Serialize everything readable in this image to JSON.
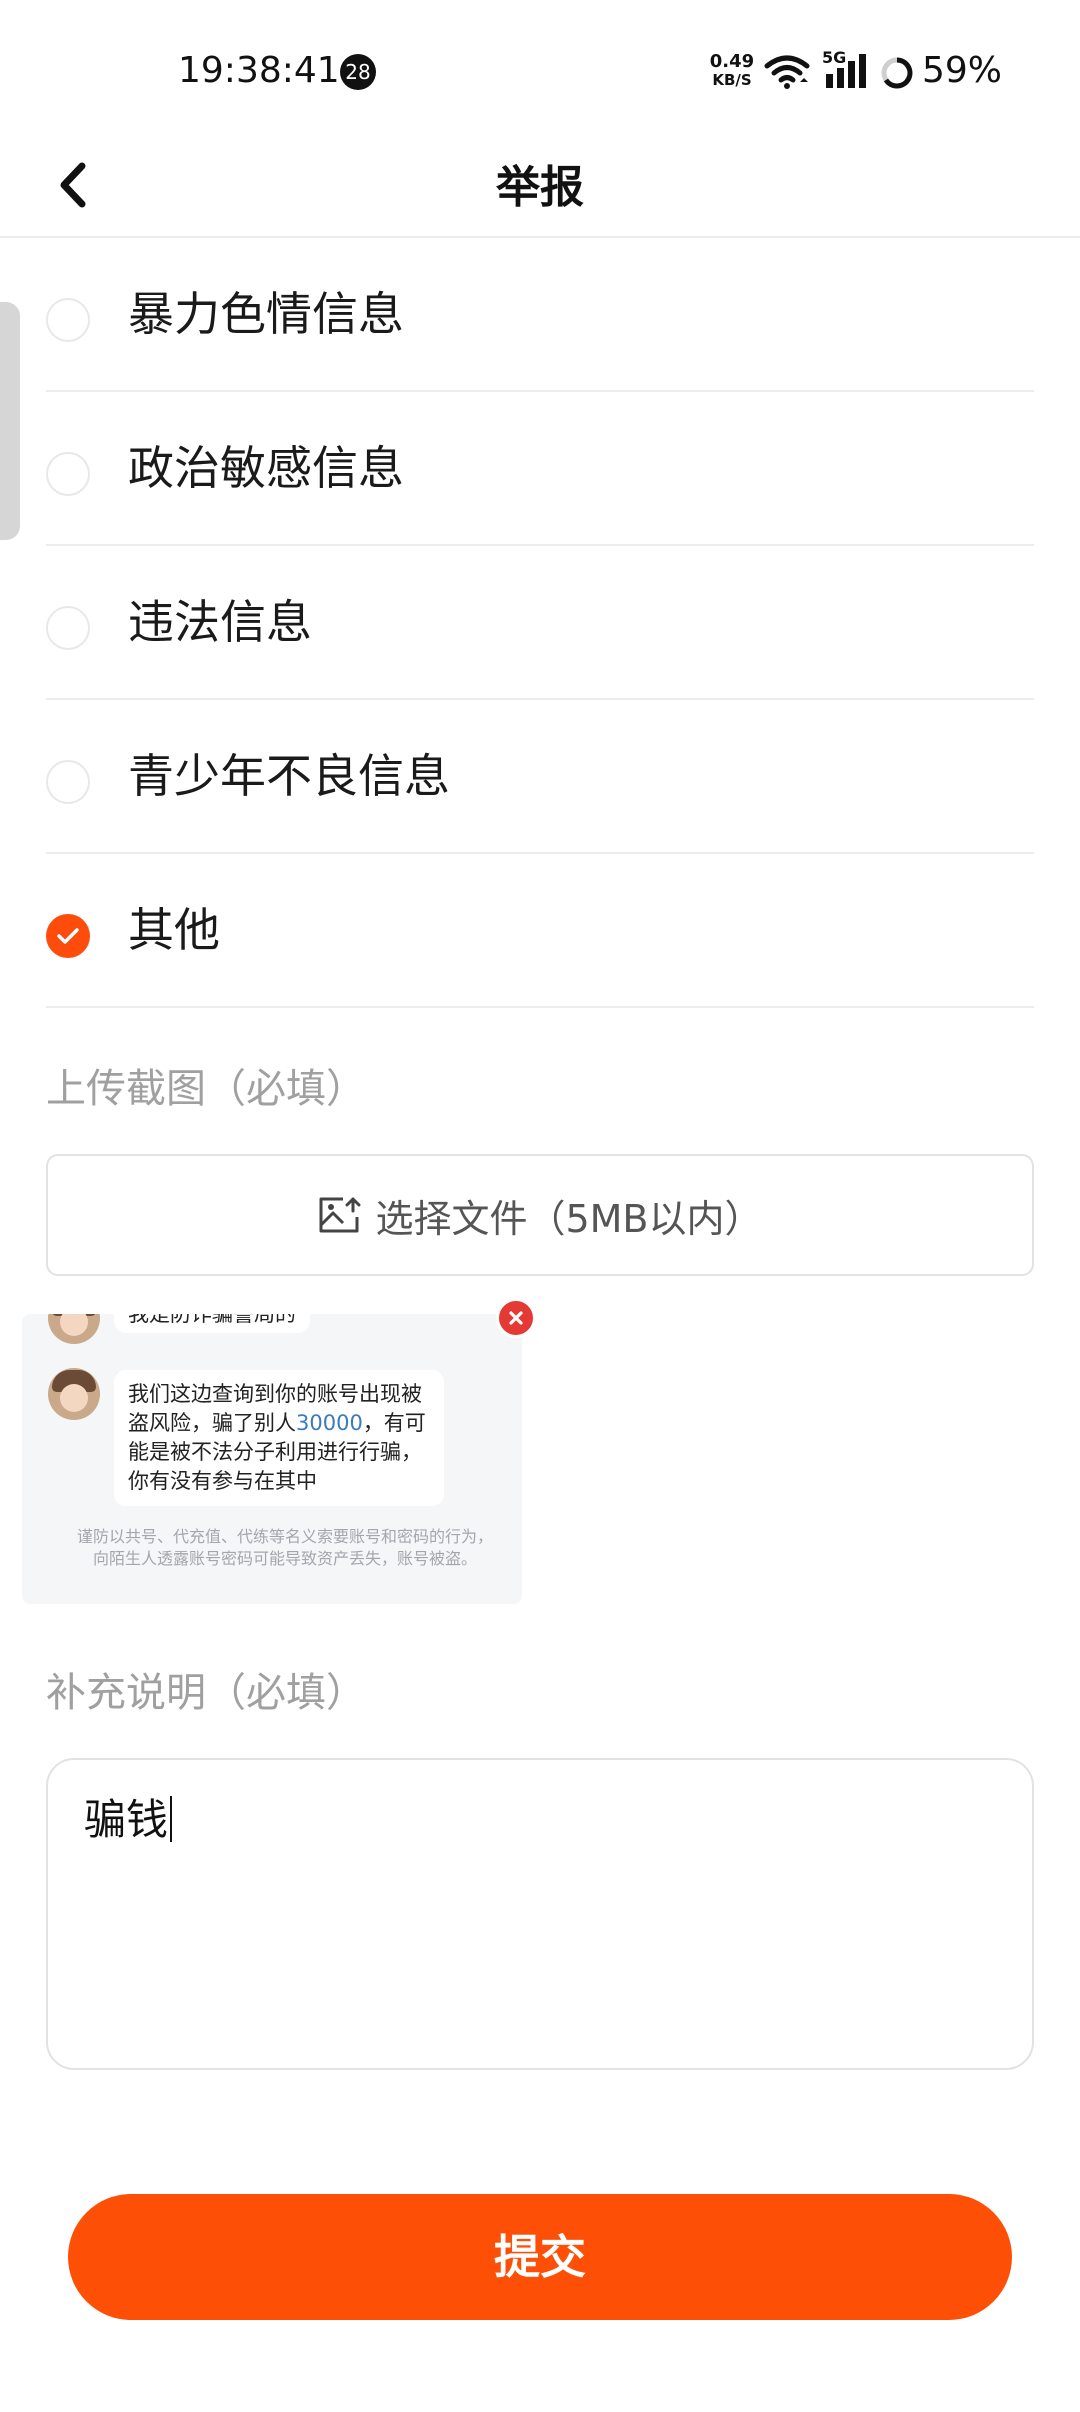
{
  "status_bar": {
    "time": "19:38:41",
    "notification_count": "28",
    "net_speed_value": "0.49",
    "net_speed_unit": "KB/S",
    "network_type": "5G",
    "battery": "59%"
  },
  "header": {
    "title": "举报",
    "back_icon": "chevron-left-icon"
  },
  "reasons": [
    {
      "label": "暴力色情信息",
      "checked": false
    },
    {
      "label": "政治敏感信息",
      "checked": false
    },
    {
      "label": "违法信息",
      "checked": false
    },
    {
      "label": "青少年不良信息",
      "checked": false
    },
    {
      "label": "其他",
      "checked": true
    }
  ],
  "upload": {
    "label": "上传截图（必填）",
    "button_label": "选择文件（5MB以内）",
    "button_icon": "image-add-icon"
  },
  "screenshot": {
    "top_message": "我是防诈骗警局的",
    "message_parts": [
      "我们这边查询到你的账号出现被",
      "盗风险，骗了别人",
      "30000",
      "，有可",
      "能是被不法分子利用进行行骗，",
      "你有没有参与在其中"
    ],
    "note": "谨防以共号、代充值、代练等名义索要账号和密码的行为，向陌生人透露账号密码可能导致资产丢失，账号被盗。",
    "delete_icon": "close-circle-icon"
  },
  "description": {
    "label": "补充说明（必填）",
    "value": "骗钱"
  },
  "submit_label": "提交",
  "colors": {
    "accent": "#fd4f05",
    "delete": "#e53935",
    "link_number": "#3a7bbf"
  }
}
